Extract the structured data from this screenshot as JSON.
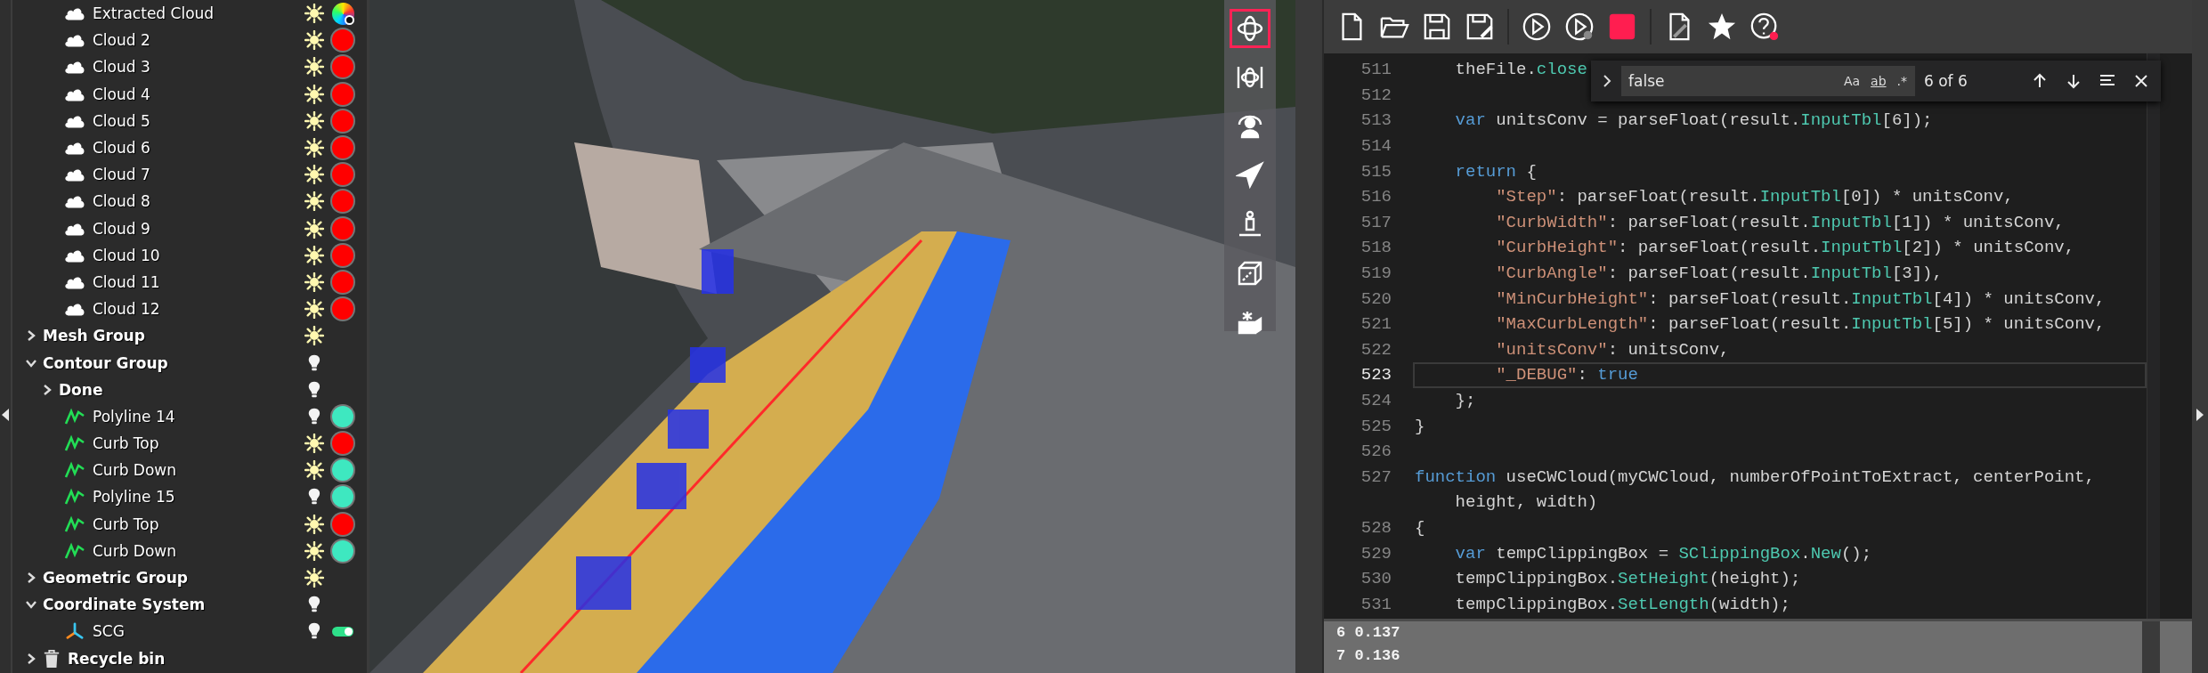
{
  "tree": {
    "continued_items": [
      {
        "label": "Extracted Cloud",
        "kind": "cloud",
        "light_on": true,
        "swatch": {
          "kind": "gradient"
        }
      },
      {
        "label": "Cloud 2",
        "kind": "cloud",
        "light_on": true,
        "swatch": {
          "kind": "dot",
          "color": "#ff0000"
        }
      },
      {
        "label": "Cloud 3",
        "kind": "cloud",
        "light_on": true,
        "swatch": {
          "kind": "dot",
          "color": "#ff0000"
        }
      },
      {
        "label": "Cloud 4",
        "kind": "cloud",
        "light_on": true,
        "swatch": {
          "kind": "dot",
          "color": "#ff0000"
        }
      },
      {
        "label": "Cloud 5",
        "kind": "cloud",
        "light_on": true,
        "swatch": {
          "kind": "dot",
          "color": "#ff0000"
        }
      },
      {
        "label": "Cloud 6",
        "kind": "cloud",
        "light_on": true,
        "swatch": {
          "kind": "dot",
          "color": "#ff0000"
        }
      },
      {
        "label": "Cloud 7",
        "kind": "cloud",
        "light_on": true,
        "swatch": {
          "kind": "dot",
          "color": "#ff0000"
        }
      },
      {
        "label": "Cloud 8",
        "kind": "cloud",
        "light_on": true,
        "swatch": {
          "kind": "dot",
          "color": "#ff0000"
        }
      },
      {
        "label": "Cloud 9",
        "kind": "cloud",
        "light_on": true,
        "swatch": {
          "kind": "dot",
          "color": "#ff0000"
        }
      },
      {
        "label": "Cloud 10",
        "kind": "cloud",
        "light_on": true,
        "swatch": {
          "kind": "dot",
          "color": "#ff0000"
        }
      },
      {
        "label": "Cloud 11",
        "kind": "cloud",
        "light_on": true,
        "swatch": {
          "kind": "dot",
          "color": "#ff0000"
        }
      },
      {
        "label": "Cloud 12",
        "kind": "cloud",
        "light_on": true,
        "swatch": {
          "kind": "dot",
          "color": "#ff0000"
        }
      }
    ],
    "items": [
      {
        "label": "Mesh Group",
        "kind": "group",
        "expanded": false,
        "light_on": true
      },
      {
        "label": "Contour Group",
        "kind": "group",
        "expanded": true,
        "light_on": false,
        "children": [
          {
            "label": "Done",
            "kind": "group",
            "expanded": false,
            "light_on": false
          },
          {
            "label": "Polyline 14",
            "kind": "polyline",
            "light_on": false,
            "swatch": {
              "kind": "dot",
              "color": "#3ee8c0"
            }
          },
          {
            "label": "Curb Top",
            "kind": "polyline",
            "light_on": true,
            "swatch": {
              "kind": "dot",
              "color": "#ff0000"
            }
          },
          {
            "label": "Curb Down",
            "kind": "polyline",
            "light_on": true,
            "swatch": {
              "kind": "dot",
              "color": "#3ee8c0"
            }
          },
          {
            "label": "Polyline 15",
            "kind": "polyline",
            "light_on": false,
            "swatch": {
              "kind": "dot",
              "color": "#3ee8c0"
            }
          },
          {
            "label": "Curb Top",
            "kind": "polyline",
            "light_on": true,
            "swatch": {
              "kind": "dot",
              "color": "#ff0000"
            }
          },
          {
            "label": "Curb Down",
            "kind": "polyline",
            "light_on": true,
            "swatch": {
              "kind": "dot",
              "color": "#3ee8c0"
            }
          }
        ]
      },
      {
        "label": "Geometric Group",
        "kind": "group",
        "expanded": false,
        "light_on": true
      },
      {
        "label": "Coordinate System",
        "kind": "group",
        "expanded": true,
        "light_on": false,
        "children": [
          {
            "label": "SCG",
            "kind": "axes",
            "light_on": false,
            "swatch": {
              "kind": "toggle",
              "on": true
            }
          }
        ]
      },
      {
        "label": "Recycle bin",
        "kind": "recycle",
        "expanded": false
      }
    ]
  },
  "view_tools": [
    {
      "kind": "orbit",
      "selected": true
    },
    {
      "kind": "orbit-pan",
      "selected": false
    },
    {
      "kind": "user-rotate",
      "selected": false
    },
    {
      "kind": "plane",
      "selected": false
    },
    {
      "kind": "figure",
      "selected": false
    },
    {
      "kind": "box-section",
      "selected": false
    },
    {
      "kind": "box-open",
      "selected": false
    }
  ],
  "toolbar": [
    {
      "kind": "new"
    },
    {
      "kind": "open"
    },
    {
      "kind": "save"
    },
    {
      "kind": "save-as"
    },
    {
      "kind": "separator"
    },
    {
      "kind": "run"
    },
    {
      "kind": "run-step"
    },
    {
      "kind": "stop"
    },
    {
      "kind": "separator"
    },
    {
      "kind": "document"
    },
    {
      "kind": "star"
    },
    {
      "kind": "help"
    }
  ],
  "find": {
    "value": "false",
    "options": [
      "Aa",
      "ab",
      ".*"
    ],
    "count": "6 of 6"
  },
  "code": [
    {
      "number": "511",
      "current": false,
      "tokens": [
        {
          "kind": "plain",
          "text": "    theFile."
        },
        {
          "kind": "fn",
          "text": "close"
        }
      ]
    },
    {
      "number": "512",
      "current": false
    },
    {
      "number": "513",
      "current": false,
      "tokens": [
        {
          "kind": "kw",
          "text": "    var"
        },
        {
          "kind": "plain",
          "text": " unitsConv = parseFloat(result."
        },
        {
          "kind": "fn",
          "text": "InputTbl"
        },
        {
          "kind": "plain",
          "text": "[6]);"
        }
      ]
    },
    {
      "number": "514",
      "current": false
    },
    {
      "number": "515",
      "current": false,
      "tokens": [
        {
          "kind": "kw",
          "text": "    return"
        },
        {
          "kind": "plain",
          "text": " {"
        }
      ]
    },
    {
      "number": "516",
      "current": false,
      "tokens": [
        {
          "kind": "str",
          "text": "        \"Step\""
        },
        {
          "kind": "plain",
          "text": ": parseFloat(result."
        },
        {
          "kind": "fn",
          "text": "InputTbl"
        },
        {
          "kind": "plain",
          "text": "[0]) * unitsConv,"
        }
      ]
    },
    {
      "number": "517",
      "current": false,
      "tokens": [
        {
          "kind": "str",
          "text": "        \"CurbWidth\""
        },
        {
          "kind": "plain",
          "text": ": parseFloat(result."
        },
        {
          "kind": "fn",
          "text": "InputTbl"
        },
        {
          "kind": "plain",
          "text": "[1]) * unitsConv,"
        }
      ]
    },
    {
      "number": "518",
      "current": false,
      "tokens": [
        {
          "kind": "str",
          "text": "        \"CurbHeight\""
        },
        {
          "kind": "plain",
          "text": ": parseFloat(result."
        },
        {
          "kind": "fn",
          "text": "InputTbl"
        },
        {
          "kind": "plain",
          "text": "[2]) * unitsConv,"
        }
      ]
    },
    {
      "number": "519",
      "current": false,
      "tokens": [
        {
          "kind": "str",
          "text": "        \"CurbAngle\""
        },
        {
          "kind": "plain",
          "text": ": parseFloat(result."
        },
        {
          "kind": "fn",
          "text": "InputTbl"
        },
        {
          "kind": "plain",
          "text": "[3]),"
        }
      ]
    },
    {
      "number": "520",
      "current": false,
      "tokens": [
        {
          "kind": "str",
          "text": "        \"MinCurbHeight\""
        },
        {
          "kind": "plain",
          "text": ": parseFloat(result."
        },
        {
          "kind": "fn",
          "text": "InputTbl"
        },
        {
          "kind": "plain",
          "text": "[4]) * unitsConv,"
        }
      ]
    },
    {
      "number": "521",
      "current": false,
      "tokens": [
        {
          "kind": "str",
          "text": "        \"MaxCurbLength\""
        },
        {
          "kind": "plain",
          "text": ": parseFloat(result."
        },
        {
          "kind": "fn",
          "text": "InputTbl"
        },
        {
          "kind": "plain",
          "text": "[5]) * unitsConv,"
        }
      ]
    },
    {
      "number": "522",
      "current": false,
      "tokens": [
        {
          "kind": "str",
          "text": "        \"unitsConv\""
        },
        {
          "kind": "plain",
          "text": ": unitsConv,"
        }
      ]
    },
    {
      "number": "523",
      "current": true,
      "tokens": [
        {
          "kind": "str",
          "text": "        \"_DEBUG\""
        },
        {
          "kind": "plain",
          "text": ": "
        },
        {
          "kind": "kw",
          "text": "true"
        }
      ]
    },
    {
      "number": "524",
      "current": false,
      "tokens": [
        {
          "kind": "plain",
          "text": "    };"
        }
      ]
    },
    {
      "number": "525",
      "current": false,
      "tokens": [
        {
          "kind": "plain",
          "text": "}"
        }
      ]
    },
    {
      "number": "526",
      "current": false
    },
    {
      "number": "527",
      "current": false,
      "tokens": [
        {
          "kind": "kw",
          "text": "function"
        },
        {
          "kind": "plain",
          "text": " useCWCloud(myCWCloud, numberOfPointToExtract, centerPoint,"
        }
      ]
    },
    {
      "current": false,
      "tokens": [
        {
          "kind": "plain",
          "text": "    height, width)"
        }
      ]
    },
    {
      "number": "528",
      "current": false,
      "tokens": [
        {
          "kind": "plain",
          "text": "{"
        }
      ]
    },
    {
      "number": "529",
      "current": false,
      "tokens": [
        {
          "kind": "kw",
          "text": "    var"
        },
        {
          "kind": "plain",
          "text": " tempClippingBox = "
        },
        {
          "kind": "fn",
          "text": "SClippingBox"
        },
        {
          "kind": "plain",
          "text": "."
        },
        {
          "kind": "fn",
          "text": "New"
        },
        {
          "kind": "plain",
          "text": "();"
        }
      ]
    },
    {
      "number": "530",
      "current": false,
      "tokens": [
        {
          "kind": "plain",
          "text": "    tempClippingBox."
        },
        {
          "kind": "fn",
          "text": "SetHeight"
        },
        {
          "kind": "plain",
          "text": "(height);"
        }
      ]
    },
    {
      "number": "531",
      "current": false,
      "tokens": [
        {
          "kind": "plain",
          "text": "    tempClippingBox."
        },
        {
          "kind": "fn",
          "text": "SetLength"
        },
        {
          "kind": "plain",
          "text": "(width);"
        }
      ]
    }
  ],
  "output": {
    "lines": [
      "6 0.137",
      "7 0.136"
    ]
  }
}
